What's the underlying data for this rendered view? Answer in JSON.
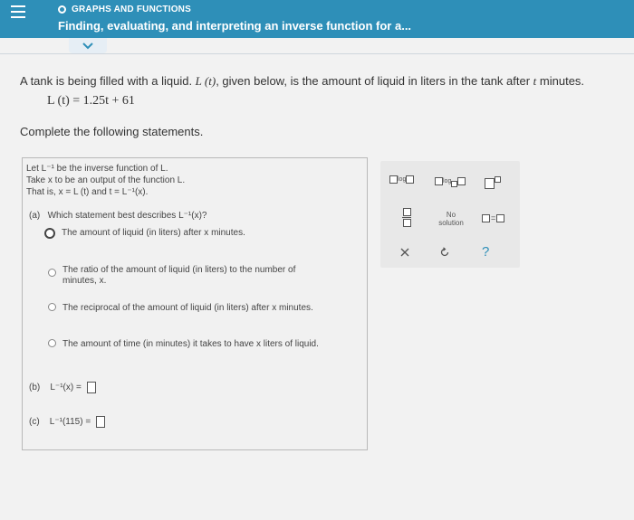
{
  "header": {
    "topic": "GRAPHS AND FUNCTIONS",
    "title": "Finding, evaluating, and interpreting an inverse function for a..."
  },
  "question": {
    "prompt_before": "A tank is being filled with a liquid. ",
    "func_name": "L (t)",
    "prompt_after": ", given below, is the amount of liquid in liters in the tank after ",
    "t_var": "t",
    "prompt_end": " minutes.",
    "formula": "L (t) = 1.25t + 61",
    "instruction": "Complete the following statements."
  },
  "answer_area": {
    "given_lines": [
      "Let L⁻¹ be the inverse function of L.",
      "Take x to be an output of the function L.",
      "That is, x = L (t) and t = L⁻¹(x)."
    ],
    "part_a_label": "(a)",
    "part_a_question": "Which statement best describes L⁻¹(x)?",
    "options": [
      {
        "text": "The amount of liquid (in liters) after x minutes.",
        "selected": true
      },
      {
        "text": "The ratio of the amount of liquid (in liters) to the number of minutes, x.",
        "selected": false
      },
      {
        "text": "The reciprocal of the amount of liquid (in liters) after x minutes.",
        "selected": false
      },
      {
        "text": "The amount of time (in minutes) it takes to have x liters of liquid.",
        "selected": false
      }
    ],
    "part_b_label": "(b)",
    "part_b_expr": "L⁻¹(x) =",
    "part_c_label": "(c)",
    "part_c_expr": "L⁻¹(115) ="
  },
  "palette": {
    "log_label": "log",
    "log_base_label": "log",
    "no_solution_label": "No solution",
    "equals_label": "=",
    "clear_icon": "close-icon",
    "undo_icon": "undo-icon",
    "help_label": "?"
  },
  "colors": {
    "header_bg": "#2e8fb8",
    "accent": "#2e8fb8",
    "help": "#2e8fb8"
  }
}
